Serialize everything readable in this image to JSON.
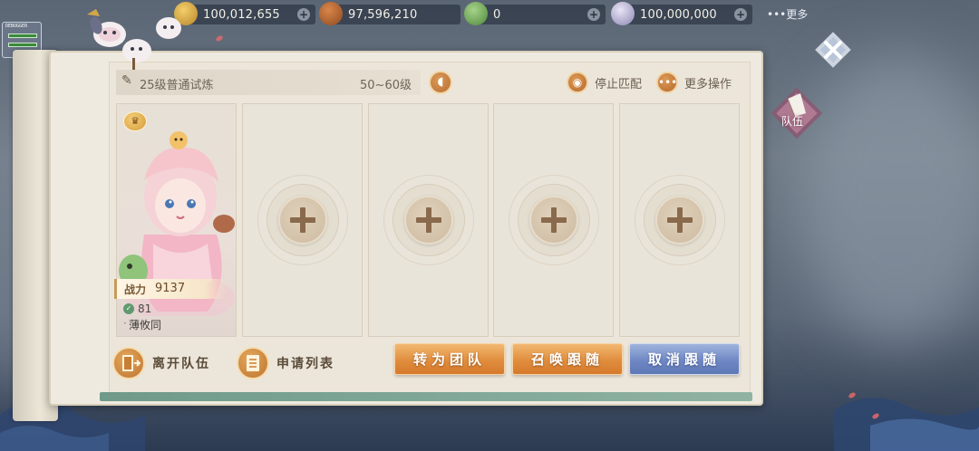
{
  "resources": [
    {
      "name": "gold-coin",
      "value": "100,012,655"
    },
    {
      "name": "copper-coin",
      "value": "97,596,210"
    },
    {
      "name": "jade-leaf",
      "value": "0"
    },
    {
      "name": "silver-ingot",
      "value": "100,000,000"
    }
  ],
  "more_top_label": "•••更多",
  "debugger_label": "DEBUGGER",
  "team_tab_label": "队伍",
  "header": {
    "activity": "25级普通试炼",
    "level_range": "50~60级",
    "stop_match_label": "停止匹配",
    "more_ops_label": "更多操作"
  },
  "leader": {
    "power_label": "战力",
    "power_value": "9137",
    "level": "81",
    "name": "薄攸同"
  },
  "empty_slots": 4,
  "buttons": {
    "leave_team": "离开队伍",
    "apply_list": "申请列表",
    "convert_group": "转为团队",
    "summon_follow": "召唤跟随",
    "cancel_follow": "取消跟随"
  },
  "colors": {
    "accent_orange": "#e08d3d",
    "accent_blue": "#6f88c4",
    "panel_bg": "#efeadf"
  }
}
